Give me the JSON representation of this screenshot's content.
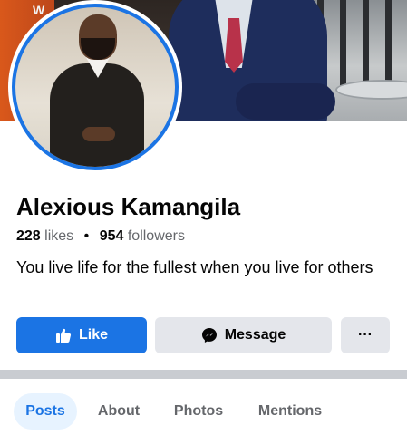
{
  "cover": {
    "text": "W"
  },
  "profile": {
    "name": "Alexious Kamangila",
    "likes_count": "228",
    "likes_label": "likes",
    "separator": "•",
    "followers_count": "954",
    "followers_label": "followers",
    "bio": "You live life for the fullest when you live for others"
  },
  "actions": {
    "like_label": "Like",
    "message_label": "Message",
    "more_label": "···"
  },
  "tabs": [
    {
      "label": "Posts",
      "active": true
    },
    {
      "label": "About",
      "active": false
    },
    {
      "label": "Photos",
      "active": false
    },
    {
      "label": "Mentions",
      "active": false
    }
  ],
  "colors": {
    "accent": "#1b74e4",
    "button_secondary": "#e4e6eb",
    "active_tab_bg": "#e7f3ff",
    "muted_text": "#65676b"
  },
  "icons": [
    "like-thumb-icon",
    "messenger-icon",
    "more-dots-icon"
  ]
}
